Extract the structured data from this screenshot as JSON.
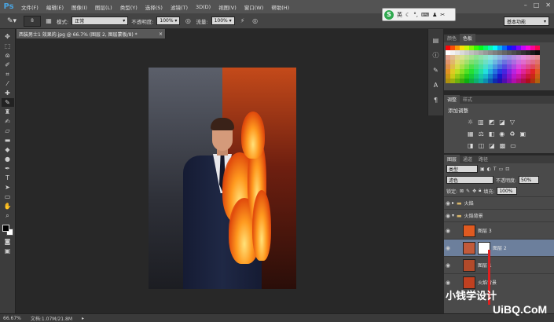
{
  "app": {
    "logo": "Ps"
  },
  "menu": [
    "文件(F)",
    "编辑(E)",
    "图像(I)",
    "图层(L)",
    "类型(Y)",
    "选择(S)",
    "滤镜(T)",
    "3D(D)",
    "视图(V)",
    "窗口(W)",
    "帮助(H)"
  ],
  "options": {
    "brush_size": "8",
    "mode_label": "模式:",
    "mode_value": "正常",
    "opacity_label": "不透明度:",
    "opacity_value": "100%",
    "flow_label": "流量:",
    "flow_value": "100%"
  },
  "ime": {
    "logo": "S",
    "lang": "英"
  },
  "workspace": "基本功能",
  "document": {
    "tab_title": "西装男士1 效果的.jpg @ 66.7% (图层 2, 图层蒙板/8) *",
    "close": "×"
  },
  "panels": {
    "color_tabs": [
      "颜色",
      "色板"
    ],
    "adjustments_tabs": [
      "调整",
      "样式"
    ],
    "adjustments_title": "添加调整",
    "layers_tabs": [
      "图层",
      "通道",
      "路径"
    ],
    "kind_filter": "类型",
    "blend_mode": "滤色",
    "opacity_label": "不透明度:",
    "opacity_value": "50%",
    "lock_label": "锁定:",
    "fill_label": "填充:",
    "fill_value": "100%",
    "layers": [
      {
        "name": "火焰",
        "type": "group"
      },
      {
        "name": "火焰背景",
        "type": "group"
      },
      {
        "name": "图层 3",
        "type": "layer"
      },
      {
        "name": "图层 2",
        "type": "layer-with-mask",
        "selected": true
      },
      {
        "name": "图层 1",
        "type": "layer"
      },
      {
        "name": "火焰背景",
        "type": "layer"
      }
    ]
  },
  "status": {
    "zoom": "66.67%",
    "doc_info": "文档:1.07M/21.8M"
  },
  "watermark": {
    "line1": "小钱学设计",
    "line2": "UiBQ.CoM"
  },
  "colors": {
    "accent": "#4aa3df",
    "selection": "#6c7f9c",
    "ime_green": "#2fa84f"
  }
}
